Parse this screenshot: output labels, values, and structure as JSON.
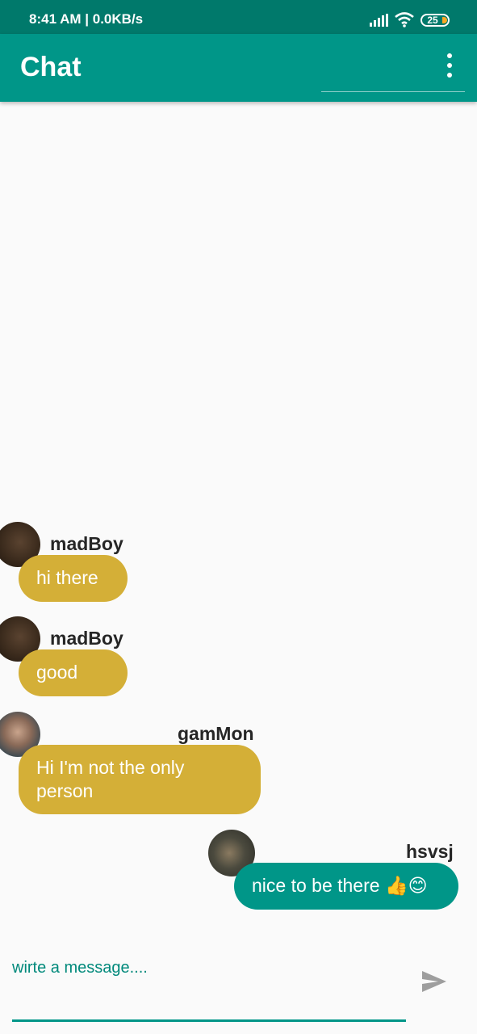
{
  "status_bar": {
    "time_speed": "8:41 AM | 0.0KB/s",
    "battery": "25",
    "icons": [
      "signal-icon",
      "wifi-icon",
      "battery-icon"
    ]
  },
  "app_bar": {
    "title": "Chat",
    "menu_icon": "more-vert-icon"
  },
  "messages": [
    {
      "sender": "madBoy",
      "text": "hi there",
      "bubble_color": "#d4af37"
    },
    {
      "sender": "madBoy",
      "text": "good",
      "bubble_color": "#d4af37"
    },
    {
      "sender": "gamMon",
      "text": "Hi I'm not the only person",
      "bubble_color": "#d4af37"
    },
    {
      "sender": "hsvsj",
      "text": "nice to be there 👍😊",
      "bubble_color": "#009688"
    }
  ],
  "composer": {
    "placeholder": "wirte a message....",
    "send_icon": "send-icon"
  },
  "colors": {
    "primary": "#009688",
    "primary_dark": "#00796b",
    "accent_bubble": "#d4af37"
  }
}
